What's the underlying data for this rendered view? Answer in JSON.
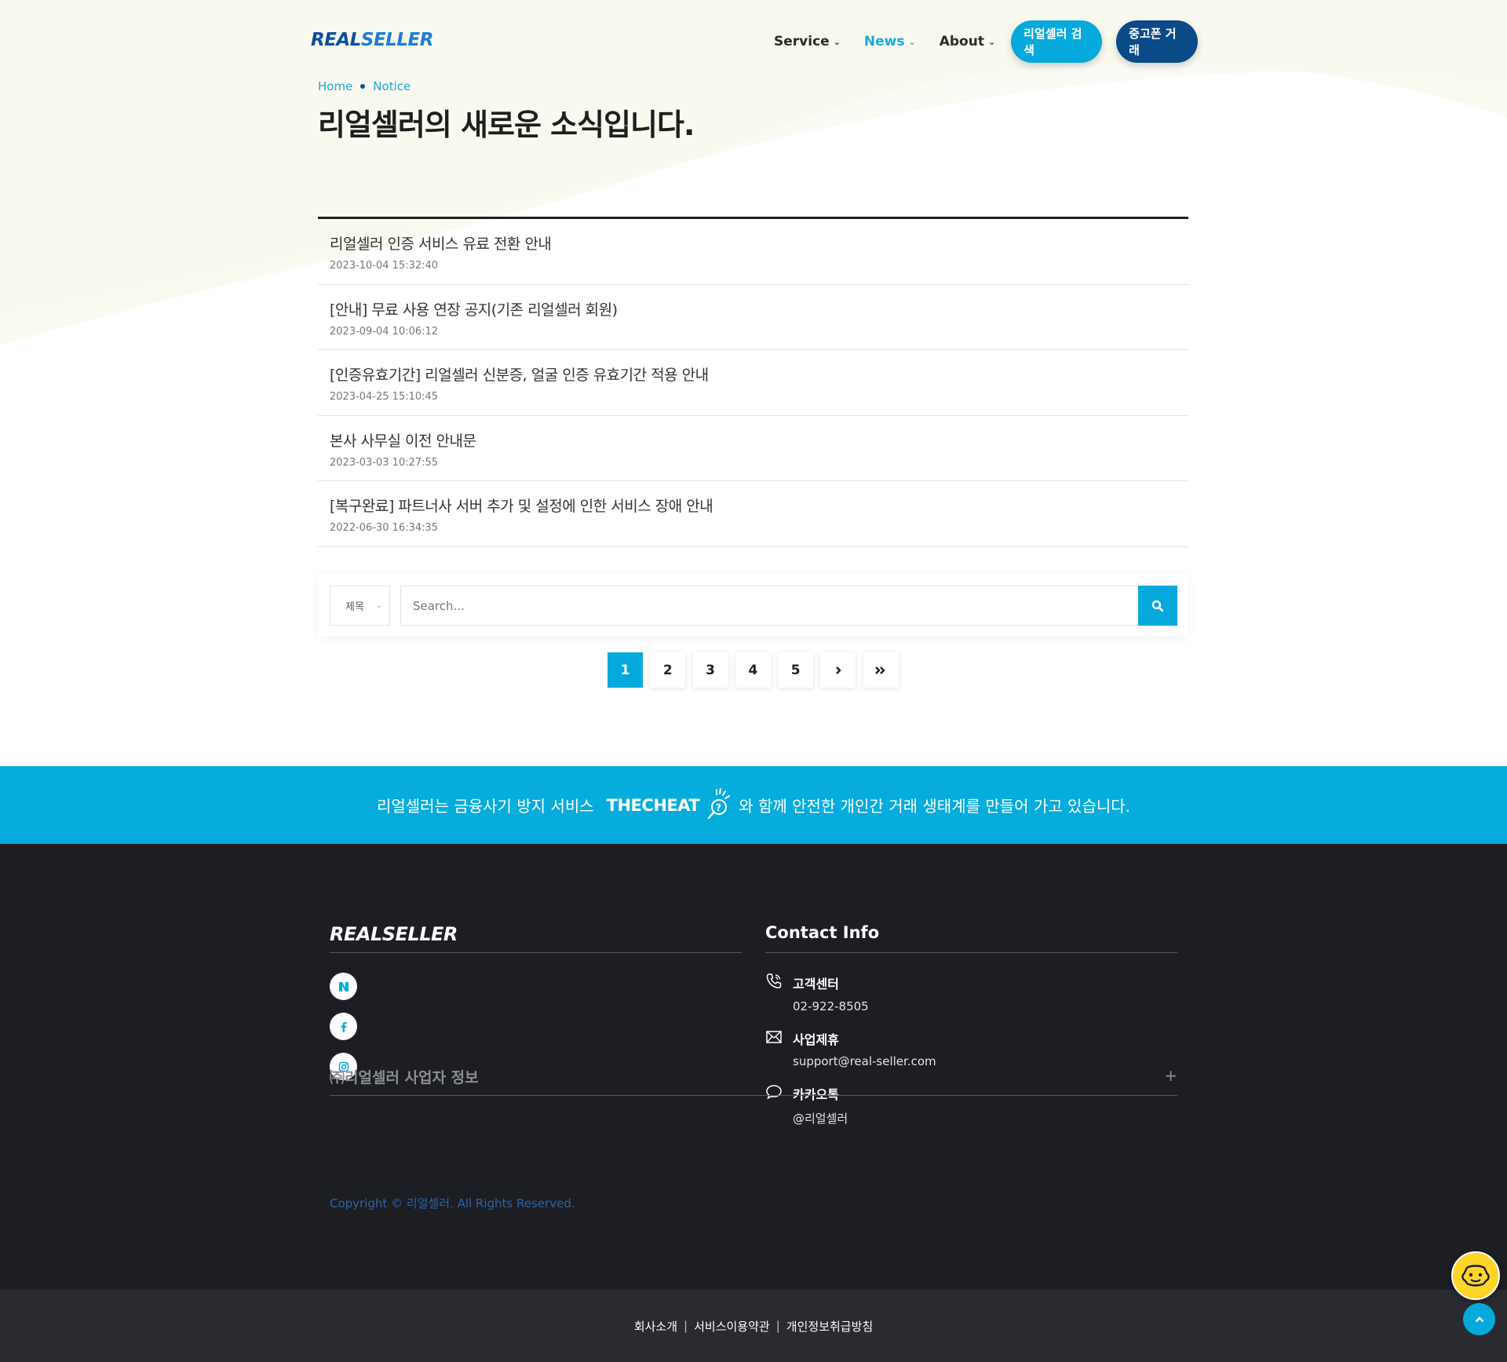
{
  "header": {
    "logo": {
      "part1": "REAL",
      "part2": "SELLER"
    },
    "nav": [
      {
        "label": "Service"
      },
      {
        "label": "News"
      },
      {
        "label": "About"
      }
    ],
    "search_button": "리얼셀러 검색",
    "trade_button": "중고폰 거래"
  },
  "breadcrumb": {
    "home": "Home",
    "current": "Notice"
  },
  "page_title": "리얼셀러의 새로운 소식입니다.",
  "notices": [
    {
      "title": "리얼셀러 인증 서비스 유료 전환 안내",
      "date": "2023-10-04 15:32:40"
    },
    {
      "title": "[안내] 무료 사용 연장 공지(기존 리얼셀러 회원)",
      "date": "2023-09-04 10:06:12"
    },
    {
      "title": "[인증유효기간] 리얼셀러 신분증, 얼굴 인증 유효기간 적용 안내",
      "date": "2023-04-25 15:10:45"
    },
    {
      "title": "본사 사무실 이전 안내문",
      "date": "2023-03-03 10:27:55"
    },
    {
      "title": "[복구완료] 파트너사 서버 추가 및 설정에 인한 서비스 장애 안내",
      "date": "2022-06-30 16:34:35"
    }
  ],
  "search": {
    "select_value": "제목",
    "placeholder": "Search..."
  },
  "pagination": {
    "pages": [
      "1",
      "2",
      "3",
      "4",
      "5"
    ],
    "current": "1"
  },
  "banner": {
    "before": "리얼셀러는 금융사기 방지 서비스",
    "brand": "THECHEAT",
    "after": "와 함께 안전한 개인간 거래 생태계를 만들어 가고 있습니다."
  },
  "footer": {
    "logo": "REALSELLER",
    "contact_title": "Contact Info",
    "contacts": [
      {
        "label": "고객센터",
        "value": "02-922-8505"
      },
      {
        "label": "사업제휴",
        "value": "support@real-seller.com"
      },
      {
        "label": "카카오톡",
        "value": "@리얼셀러"
      }
    ],
    "business_info": "㈜리얼셀러 사업자 정보",
    "copyright": "Copyright © 리얼셀러. All Rights Reserved.",
    "links": [
      "회사소개",
      "서비스이용약관",
      "개인정보취급방침"
    ]
  },
  "colors": {
    "accent": "#06a9dc",
    "navy": "#0a4a86",
    "footer_bg": "#1d1e23"
  }
}
